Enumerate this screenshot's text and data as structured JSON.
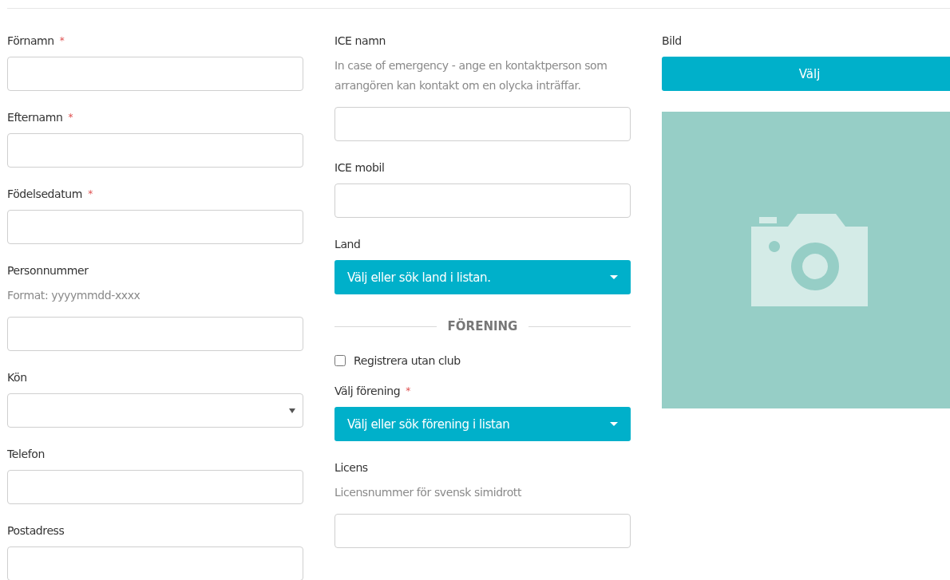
{
  "columns": [
    {
      "fields": [
        {
          "kind": "input",
          "label": "Förnamn",
          "required_mark": "*"
        },
        {
          "kind": "input",
          "label": "Efternamn",
          "required_mark": "*"
        },
        {
          "kind": "input",
          "label": "Födelsedatum",
          "required_mark": "*"
        },
        {
          "kind": "input",
          "label": "Personnummer",
          "help": "Format: yyyymmdd-xxxx"
        },
        {
          "kind": "select",
          "label": "Kön"
        },
        {
          "kind": "input",
          "label": "Telefon"
        },
        {
          "kind": "input",
          "label": "Postadress"
        }
      ]
    },
    {
      "fields": [
        {
          "kind": "input",
          "label": "ICE namn",
          "help": "In case of emergency - ange en kontaktperson som arrangören kan kontakt om en olycka inträffar."
        },
        {
          "kind": "input",
          "label": "ICE mobil"
        },
        {
          "kind": "search-select",
          "label": "Land",
          "placeholder": "Välj eller sök land i listan."
        },
        {
          "kind": "divider",
          "label": "FÖRENING"
        },
        {
          "kind": "checkbox",
          "label": "Registrera utan club",
          "checked": false
        },
        {
          "kind": "search-select",
          "label": "Välj förening",
          "required_mark": "*",
          "placeholder": "Välj eller sök förening i listan"
        },
        {
          "kind": "input",
          "label": "Licens",
          "help": "Licensnummer för svensk simidrott"
        }
      ]
    },
    {
      "fields": [
        {
          "kind": "image",
          "label": "Bild",
          "button": "Välj"
        }
      ]
    }
  ]
}
